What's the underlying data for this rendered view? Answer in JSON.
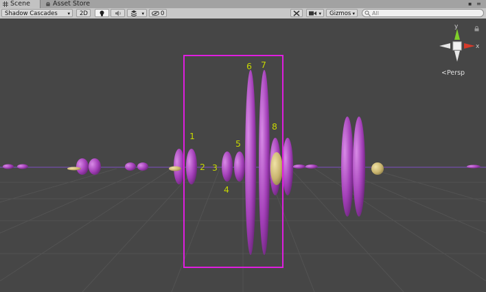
{
  "tabs": [
    {
      "label": "Scene",
      "icon": "grid-icon",
      "active": true
    },
    {
      "label": "Asset Store",
      "icon": "store-icon",
      "active": false
    }
  ],
  "toolbar": {
    "draw_mode": "Shadow Cascades",
    "mode_2d": "2D",
    "light_icon": "lightbulb-icon",
    "audio_icon": "speaker-icon",
    "effects_icon": "effects-icon",
    "hidden_count": "0",
    "tools_icon": "tools-icon",
    "camera_icon": "camera-icon",
    "gizmos_label": "Gizmos",
    "search_placeholder": "All"
  },
  "gizmo": {
    "y_label": "y",
    "x_label": "x",
    "projection_label": "Persp"
  },
  "annotations": [
    "1",
    "2",
    "3",
    "4",
    "5",
    "6",
    "7",
    "8"
  ],
  "colors": {
    "viewport_bg": "#464646",
    "grid": "#535353",
    "shadow_ellipsoid": "#a33fb8",
    "lit_ellipsoid": "#c9b46e",
    "label": "#c7d800",
    "frustum_box": "#e01ee0",
    "axis_y": "#7fcf2a",
    "axis_x": "#d63a2a"
  }
}
